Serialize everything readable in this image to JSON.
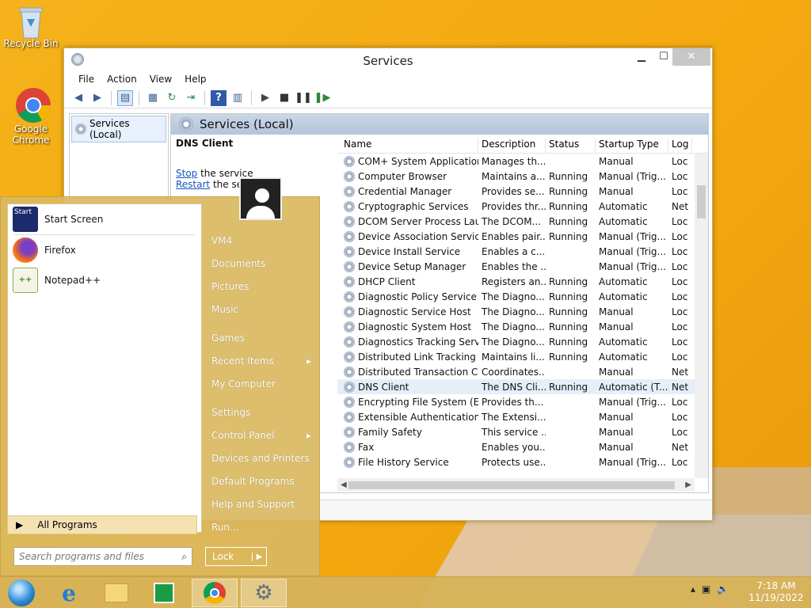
{
  "desktop": {
    "icons": [
      {
        "label": "Recycle Bin"
      },
      {
        "label": "Google Chrome"
      }
    ]
  },
  "window": {
    "title": "Services",
    "controls": {
      "min": "▁",
      "max": "☐",
      "close": "✕"
    },
    "menu": [
      "File",
      "Action",
      "View",
      "Help"
    ],
    "tree_node": "Services (Local)",
    "pane_header": "Services (Local)",
    "selected_service": "DNS Client",
    "stop_link": "Stop",
    "stop_suffix": " the service",
    "restart_link": "Restart",
    "restart_suffix": " the service"
  },
  "services": {
    "columns": [
      "Name",
      "Description",
      "Status",
      "Startup Type",
      "Log"
    ],
    "rows": [
      [
        "COM+ System Application",
        "Manages th...",
        "",
        "Manual",
        "Loc"
      ],
      [
        "Computer Browser",
        "Maintains a...",
        "Running",
        "Manual (Trig...",
        "Loc"
      ],
      [
        "Credential Manager",
        "Provides se...",
        "Running",
        "Manual",
        "Loc"
      ],
      [
        "Cryptographic Services",
        "Provides thr...",
        "Running",
        "Automatic",
        "Net"
      ],
      [
        "DCOM Server Process Laun...",
        "The DCOM...",
        "Running",
        "Automatic",
        "Loc"
      ],
      [
        "Device Association Service",
        "Enables pair...",
        "Running",
        "Manual (Trig...",
        "Loc"
      ],
      [
        "Device Install Service",
        "Enables a c...",
        "",
        "Manual (Trig...",
        "Loc"
      ],
      [
        "Device Setup Manager",
        "Enables the ...",
        "",
        "Manual (Trig...",
        "Loc"
      ],
      [
        "DHCP Client",
        "Registers an...",
        "Running",
        "Automatic",
        "Loc"
      ],
      [
        "Diagnostic Policy Service",
        "The Diagno...",
        "Running",
        "Automatic",
        "Loc"
      ],
      [
        "Diagnostic Service Host",
        "The Diagno...",
        "Running",
        "Manual",
        "Loc"
      ],
      [
        "Diagnostic System Host",
        "The Diagno...",
        "Running",
        "Manual",
        "Loc"
      ],
      [
        "Diagnostics Tracking Service",
        "The Diagno...",
        "Running",
        "Automatic",
        "Loc"
      ],
      [
        "Distributed Link Tracking Cl...",
        "Maintains li...",
        "Running",
        "Automatic",
        "Loc"
      ],
      [
        "Distributed Transaction Co...",
        "Coordinates...",
        "",
        "Manual",
        "Net"
      ],
      [
        "DNS Client",
        "The DNS Cli...",
        "Running",
        "Automatic (T...",
        "Net"
      ],
      [
        "Encrypting File System (EFS)",
        "Provides th...",
        "",
        "Manual (Trig...",
        "Loc"
      ],
      [
        "Extensible Authentication P...",
        "The Extensi...",
        "",
        "Manual",
        "Loc"
      ],
      [
        "Family Safety",
        "This service ...",
        "",
        "Manual",
        "Loc"
      ],
      [
        "Fax",
        "Enables you...",
        "",
        "Manual",
        "Net"
      ],
      [
        "File History Service",
        "Protects use...",
        "",
        "Manual (Trig...",
        "Loc"
      ]
    ]
  },
  "start_menu": {
    "left_items": [
      "Start Screen",
      "Firefox",
      "Notepad++"
    ],
    "start_tile_text": "Start",
    "all_programs": "All Programs",
    "search_placeholder": "Search programs and files",
    "right_items": [
      "VM4",
      "Documents",
      "Pictures",
      "Music",
      "Games",
      "Recent Items",
      "My Computer",
      "Settings",
      "Control Panel",
      "Devices and Printers",
      "Default Programs",
      "Help and Support",
      "Run..."
    ],
    "lock_label": "Lock"
  },
  "taskbar": {
    "time": "7:18 AM",
    "date": "11/19/2022"
  },
  "colors": {
    "desktop": "#f4a90f",
    "start_menu": "#dab860",
    "link": "#1a56b8"
  }
}
